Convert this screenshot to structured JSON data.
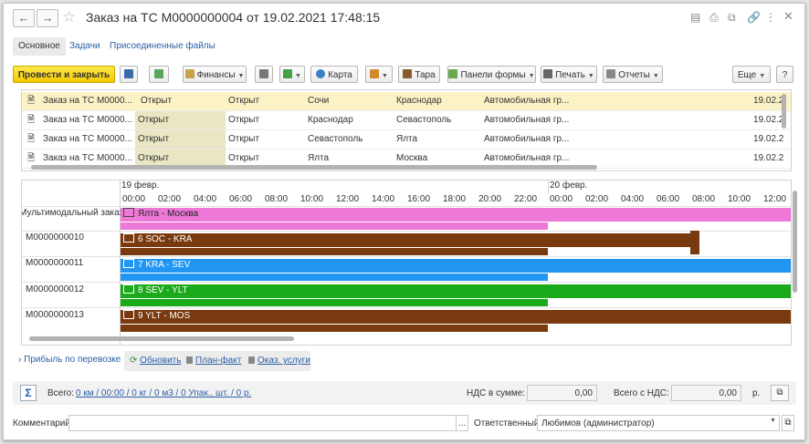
{
  "window": {
    "title": "Заказ на ТС М0000000004 от 19.02.2021 17:48:15"
  },
  "tabs": [
    {
      "label": "Основное"
    },
    {
      "label": "Задачи"
    },
    {
      "label": "Присоединенные файлы"
    }
  ],
  "toolbar": {
    "post_close": "Провести и закрыть",
    "finance": "Финансы",
    "map": "Карта",
    "container": "Тара",
    "form_panels": "Панели формы",
    "print": "Печать",
    "reports": "Отчеты",
    "more": "Еще",
    "help": "?"
  },
  "orders_table": {
    "rows": [
      {
        "name": "Заказ на ТС М0000...",
        "status1": "Открыт",
        "status2": "Открыт",
        "from": "Сочи",
        "to": "Краснодар",
        "type": "Автомобильная гр...",
        "date": "19.02.2("
      },
      {
        "name": "Заказ на ТС М0000...",
        "status1": "Открыт",
        "status2": "Открыт",
        "from": "Краснодар",
        "to": "Севастополь",
        "type": "Автомобильная гр...",
        "date": "19.02.2("
      },
      {
        "name": "Заказ на ТС М0000...",
        "status1": "Открыт",
        "status2": "Открыт",
        "from": "Севастополь",
        "to": "Ялта",
        "type": "Автомобильная гр...",
        "date": "19.02.2("
      },
      {
        "name": "Заказ на ТС М0000...",
        "status1": "Открыт",
        "status2": "Открыт",
        "from": "Ялта",
        "to": "Москва",
        "type": "Автомобильная гр...",
        "date": "19.02.2("
      }
    ]
  },
  "gantt": {
    "day1": "19 февр.",
    "day2": "20 февр.",
    "hours": [
      "00:00",
      "02:00",
      "04:00",
      "06:00",
      "08:00",
      "10:00",
      "12:00",
      "14:00",
      "16:00",
      "18:00",
      "20:00",
      "22:00",
      "00:00",
      "02:00",
      "04:00",
      "06:00",
      "08:00",
      "10:00",
      "12:00"
    ],
    "rows": [
      {
        "label": "Мультимодальный заказ",
        "bar": "Ялта - Москва",
        "color": "#ee78d8"
      },
      {
        "label": "М0000000010",
        "bar": "6 SOC - KRA",
        "color": "#7a3a10"
      },
      {
        "label": "М0000000011",
        "bar": "7 KRA - SEV",
        "color": "#2196f3"
      },
      {
        "label": "М0000000012",
        "bar": "8 SEV - YLT",
        "color": "#1aaa1a"
      },
      {
        "label": "М0000000013",
        "bar": "9 YLT - MOS",
        "color": "#7a3a10"
      }
    ]
  },
  "profit_panel": {
    "toggle": "Прибыль по перевозке",
    "refresh": "Обновить",
    "plan_fact": "План-факт",
    "services": "Оказ. услуги"
  },
  "totals": {
    "label": "Всего:",
    "value": "0 км / 00:00 / 0 кг / 0 м3 / 0 Упак., шт. / 0 р.",
    "vat_label": "НДС в сумме:",
    "vat_value": "0,00",
    "total_vat_label": "Всего с НДС:",
    "total_vat_value": "0,00",
    "currency": "р."
  },
  "comment": {
    "label": "Комментарий:",
    "value": ""
  },
  "responsible": {
    "label": "Ответственный:",
    "value": "Любимов (администратор)"
  }
}
